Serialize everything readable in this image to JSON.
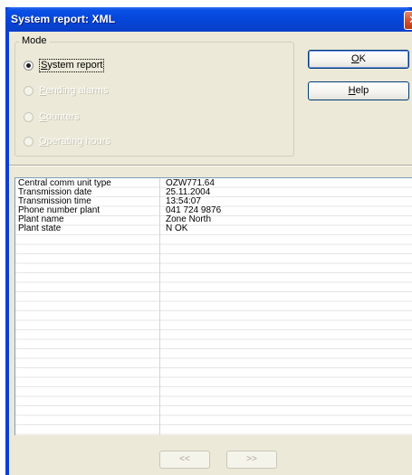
{
  "window": {
    "title": "System report: XML",
    "close_glyph": "✕"
  },
  "mode": {
    "label": "Mode",
    "options": [
      {
        "label": "System report",
        "mnemonic": "S",
        "rest": "ystem report",
        "checked": true,
        "enabled": true
      },
      {
        "label": "Pending alarms",
        "mnemonic": "P",
        "rest": "ending alarms",
        "checked": false,
        "enabled": false
      },
      {
        "label": "Counters",
        "mnemonic": "C",
        "rest": "ounters",
        "checked": false,
        "enabled": false
      },
      {
        "label": "Operating hours",
        "mnemonic": "O",
        "rest": "perating hours",
        "checked": false,
        "enabled": false
      }
    ]
  },
  "buttons": {
    "ok": {
      "mnemonic": "O",
      "rest": "K",
      "label": "OK"
    },
    "help": {
      "mnemonic": "H",
      "rest": "elp",
      "label": "Help"
    }
  },
  "report": {
    "rows": [
      {
        "name": "Central comm unit type",
        "value": "OZW771.64"
      },
      {
        "name": "Transmission date",
        "value": "25.11.2004"
      },
      {
        "name": "Transmission time",
        "value": "13:54:07"
      },
      {
        "name": "Phone number plant",
        "value": "041 724 9876"
      },
      {
        "name": "Plant name",
        "value": "Zone North"
      },
      {
        "name": "Plant state",
        "value": "N OK"
      }
    ]
  },
  "pager": {
    "prev_label": "<<",
    "next_label": ">>"
  },
  "colors": {
    "title_bar": "#0545d8",
    "dialog_face": "#ece9d8",
    "close_button": "#c03a16"
  }
}
